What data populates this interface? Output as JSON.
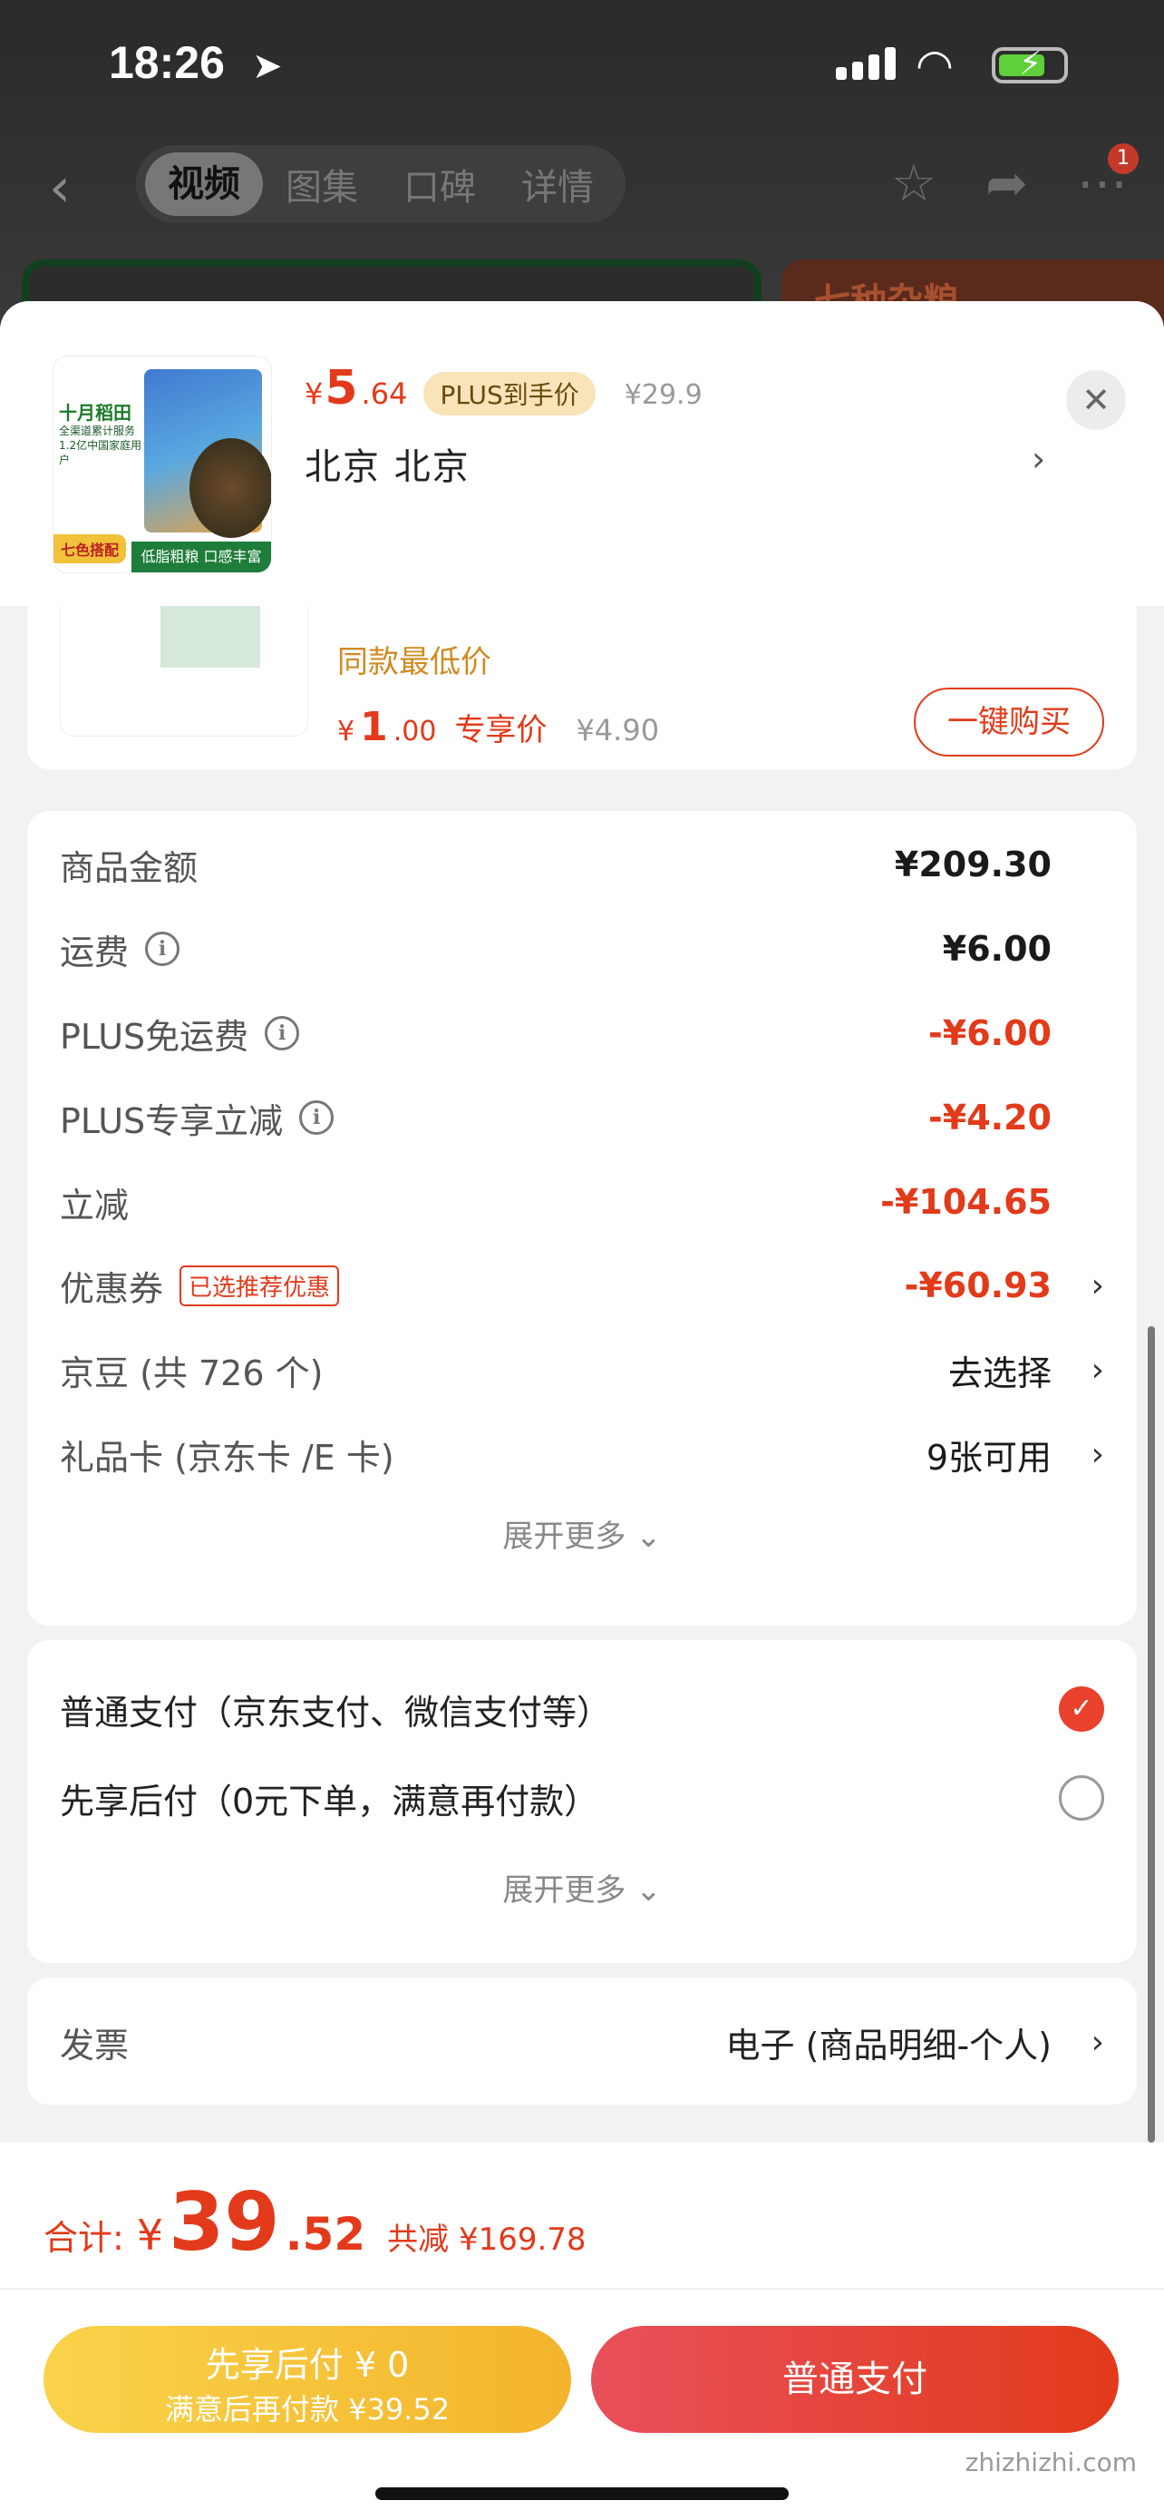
{
  "status": {
    "time": "18:26"
  },
  "nav": {
    "tabs": [
      "视频",
      "图集",
      "口碑",
      "详情"
    ],
    "badge": "1",
    "peek_text": "七种杂粮"
  },
  "product": {
    "brand": "十月稻田",
    "small_text": "全渠道累计服务 1.2亿中国家庭用户",
    "tag_left": "七色搭配",
    "tag_bottom": "低脂粗粮 口感丰富",
    "price_yen": "¥",
    "price_int": "5",
    "price_dec": ".64",
    "plus_badge": "PLUS到手价",
    "orig_price": "¥29.9",
    "address": "北京  北京"
  },
  "promo": {
    "note": "同款最低价",
    "price_yen": "¥",
    "price_int": "1",
    "price_dec": ".00",
    "label": "专享价",
    "was": "¥4.90",
    "button": "一键购买"
  },
  "fees": {
    "goods_label": "商品金额",
    "goods_value": "¥209.30",
    "ship_label": "运费",
    "ship_value": "¥6.00",
    "plus_ship_label": "PLUS免运费",
    "plus_ship_value": "-¥6.00",
    "plus_off_label": "PLUS专享立减",
    "plus_off_value": "-¥4.20",
    "instant_label": "立减",
    "instant_value": "-¥104.65",
    "coupon_label": "优惠券",
    "coupon_tag": "已选推荐优惠",
    "coupon_value": "-¥60.93",
    "beans_label": "京豆 (共 726 个)",
    "beans_value": "去选择",
    "gift_label": "礼品卡 (京东卡 /E 卡)",
    "gift_value": "9张可用",
    "expand": "展开更多 ⌄"
  },
  "payment": {
    "normal": "普通支付（京东支付、微信支付等）",
    "later": "先享后付（0元下单，满意再付款）",
    "expand": "展开更多 ⌄"
  },
  "invoice": {
    "label": "发票",
    "value": "电子 (商品明细-个人)"
  },
  "footer": {
    "total_label": "合计:",
    "yen": "¥",
    "total_int": "39",
    "total_dec": ".52",
    "saved": "共减 ¥169.78",
    "later_line1": "先享后付 ¥ 0",
    "later_line2": "满意后再付款 ¥39.52",
    "normal_button": "普通支付"
  },
  "watermark": "zhizhizhi.com",
  "colors": {
    "accent": "#e23a1a",
    "plus_badge_bg": "#f8e4b8",
    "later_btn": "#f3b42c"
  }
}
